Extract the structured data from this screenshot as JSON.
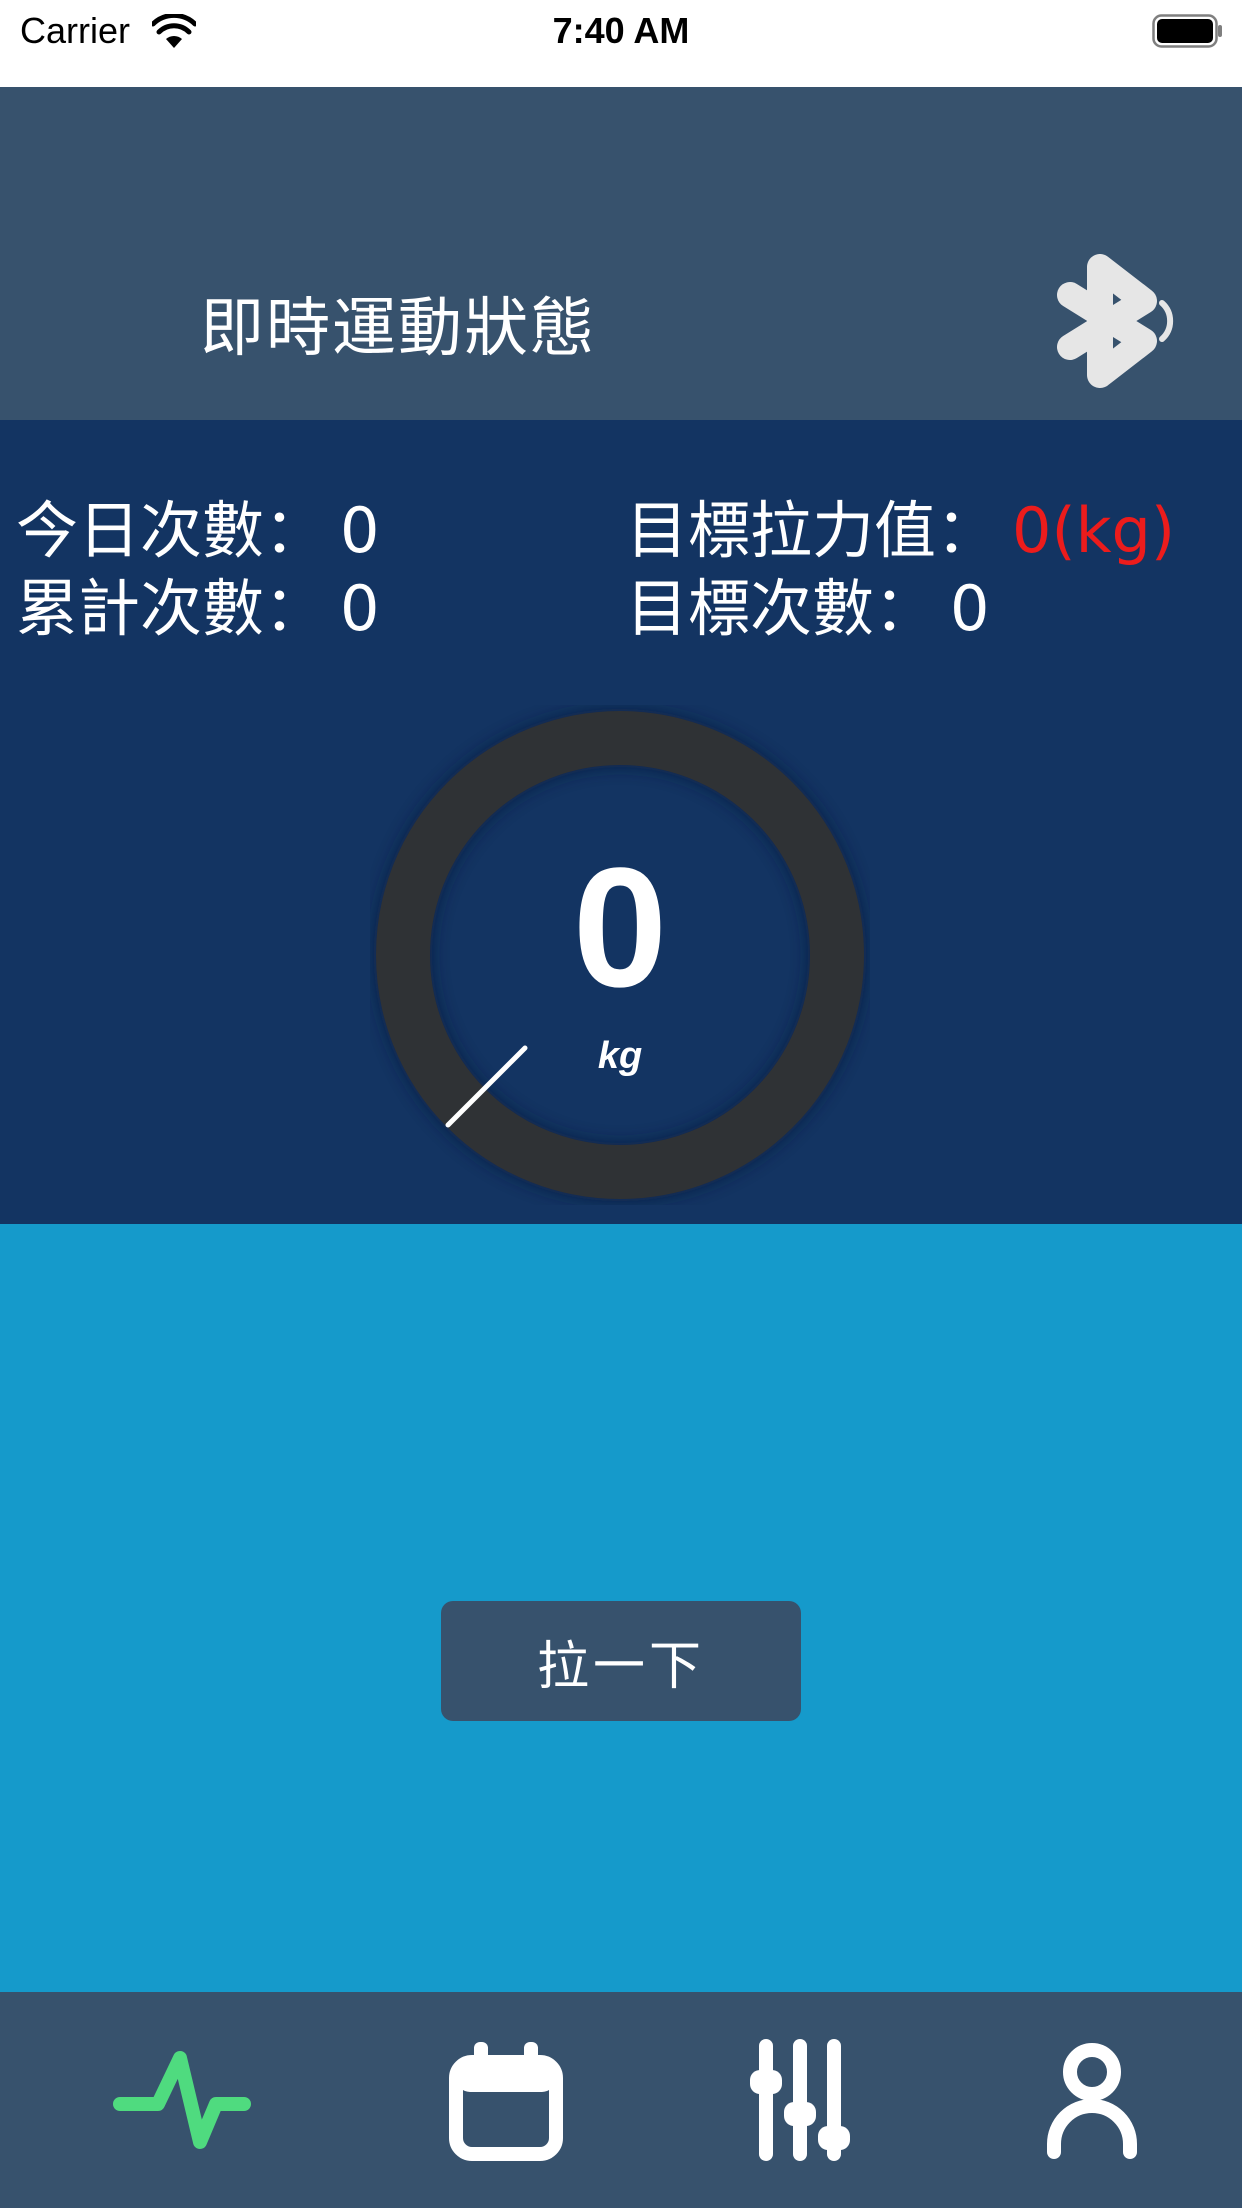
{
  "status_bar": {
    "carrier": "Carrier",
    "time": "7:40 AM"
  },
  "header": {
    "title": "即時運動狀態",
    "bluetooth_icon": "bluetooth-icon"
  },
  "stats": {
    "today_count_label": "今日次數：",
    "today_count_value": "0",
    "total_count_label": "累計次數：",
    "total_count_value": "0",
    "target_force_label": "目標拉力值：",
    "target_force_value": "0(kg)",
    "target_count_label": "目標次數：",
    "target_count_value": "0"
  },
  "gauge": {
    "value": "0",
    "unit": "kg"
  },
  "action": {
    "pull_label": "拉一下"
  },
  "tabs": [
    {
      "icon": "activity-pulse-icon",
      "active": true
    },
    {
      "icon": "calendar-icon",
      "active": false
    },
    {
      "icon": "sliders-icon",
      "active": false
    },
    {
      "icon": "user-icon",
      "active": false
    }
  ],
  "colors": {
    "header_bg": "#37526d",
    "panel_bg": "#133462",
    "action_bg": "#159acb",
    "accent_green": "#4fdb7f",
    "target_red": "#ec1c1c",
    "gauge_ring": "#2f3235"
  }
}
